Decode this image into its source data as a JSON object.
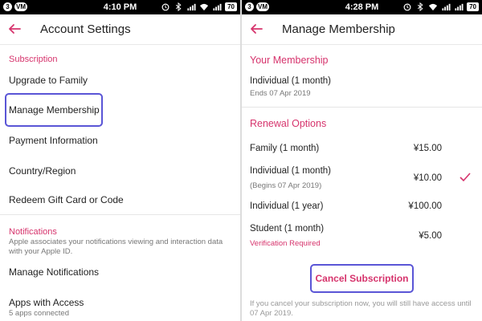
{
  "left": {
    "status": {
      "time": "4:10 PM",
      "notif": "3",
      "battery": "70"
    },
    "header": {
      "title": "Account Settings"
    },
    "subscription": {
      "heading": "Subscription",
      "items": [
        "Upgrade to Family",
        "Manage Membership",
        "Payment Information",
        "Country/Region",
        "Redeem Gift Card or Code"
      ]
    },
    "notifications": {
      "heading": "Notifications",
      "description": "Apple associates your notifications viewing and interaction data with your Apple ID.",
      "manage": "Manage Notifications",
      "apps_title": "Apps with Access",
      "apps_sub": "5 apps connected"
    }
  },
  "right": {
    "status": {
      "time": "4:28 PM",
      "notif": "3",
      "battery": "70"
    },
    "header": {
      "title": "Manage Membership"
    },
    "your_membership": {
      "heading": "Your Membership",
      "plan": "Individual (1 month)",
      "ends": "Ends 07 Apr 2019"
    },
    "renewal": {
      "heading": "Renewal Options",
      "options": [
        {
          "name": "Family (1 month)",
          "price": "¥15.00"
        },
        {
          "name": "Individual (1 month)",
          "price": "¥10.00",
          "sub": "(Begins 07 Apr 2019)",
          "selected": true
        },
        {
          "name": "Individual  (1 year)",
          "price": "¥100.00"
        },
        {
          "name": "Student (1 month)",
          "price": "¥5.00",
          "note": "Verification Required"
        }
      ]
    },
    "cancel_button": "Cancel Subscription",
    "footer": "If you cancel your subscription now, you will still have access until 07 Apr 2019."
  },
  "colors": {
    "accent": "#d6336c",
    "highlight": "#5a55d6"
  },
  "icons": [
    "back-arrow-icon",
    "checkmark-icon",
    "wifi-icon",
    "signal-icon",
    "battery-icon",
    "alarm-icon",
    "bluetooth-icon"
  ]
}
